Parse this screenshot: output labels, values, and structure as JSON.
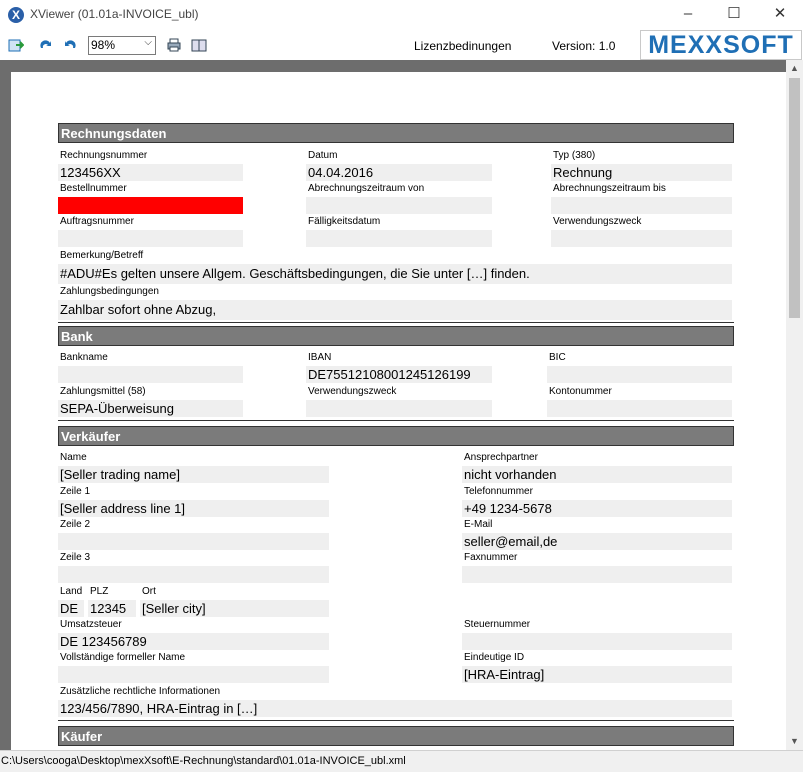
{
  "window": {
    "title": "XViewer (01.01a-INVOICE_ubl)",
    "icon": "xviewer-logo-icon",
    "minimize": "–",
    "maximize": "☐",
    "close": "✕"
  },
  "toolbar": {
    "zoom": "98%",
    "license": "Lizenzbedinungen",
    "version": "Version: 1.0",
    "logo": "MEXXSOFT",
    "accent": "#1f6fb5"
  },
  "rechnungsdaten": {
    "header": "Rechnungsdaten",
    "rechnungsnummer_label": "Rechnungsnummer",
    "rechnungsnummer": "123456XX",
    "datum_label": "Datum",
    "datum": "04.04.2016",
    "typ_label": "Typ (380)",
    "typ": "Rechnung",
    "bestellnummer_label": "Bestellnummer",
    "bestellnummer": "",
    "zeitraum_von_label": "Abrechnungszeitraum von",
    "zeitraum_von": "",
    "zeitraum_bis_label": "Abrechnungszeitraum bis",
    "zeitraum_bis": "",
    "auftragsnummer_label": "Auftragsnummer",
    "auftragsnummer": "",
    "faelligkeit_label": "Fälligkeitsdatum",
    "faelligkeit": "",
    "verwendungszweck_label": "Verwendungszweck",
    "verwendungszweck": "",
    "bemerkung_label": "Bemerkung/Betreff",
    "bemerkung": "#ADU#Es gelten unsere Allgem. Geschäftsbedingungen, die Sie unter […] finden.",
    "zahlungsbedingungen_label": "Zahlungsbedingungen",
    "zahlungsbedingungen": "Zahlbar sofort ohne Abzug,"
  },
  "bank": {
    "header": "Bank",
    "bankname_label": "Bankname",
    "bankname": "",
    "iban_label": "IBAN",
    "iban": "DE75512108001245126199",
    "bic_label": "BIC",
    "bic": "",
    "zahlungsmittel_label": "Zahlungsmittel (58)",
    "zahlungsmittel": "SEPA-Überweisung",
    "verwendungszweck_label": "Verwendungszweck",
    "verwendungszweck": "",
    "kontonummer_label": "Kontonummer",
    "kontonummer": ""
  },
  "verkaeufer": {
    "header": "Verkäufer",
    "name_label": "Name",
    "name": "[Seller trading name]",
    "ansprechpartner_label": "Ansprechpartner",
    "ansprechpartner": "nicht vorhanden",
    "zeile1_label": "Zeile 1",
    "zeile1": "[Seller address line 1]",
    "telefon_label": "Telefonnummer",
    "telefon": "+49 1234-5678",
    "zeile2_label": "Zeile 2",
    "zeile2": "",
    "email_label": "E-Mail",
    "email": "seller@email,de",
    "zeile3_label": "Zeile 3",
    "zeile3": "",
    "fax_label": "Faxnummer",
    "fax": "",
    "land_label": "Land",
    "land": "DE",
    "plz_label": "PLZ",
    "plz": "12345",
    "ort_label": "Ort",
    "ort": "[Seller city]",
    "ust_label": "Umsatzsteuer",
    "ust": "DE 123456789",
    "steuernummer_label": "Steuernummer",
    "steuernummer": "",
    "formeller_name_label": "Vollständige formeller Name",
    "formeller_name": "",
    "eindeutige_id_label": "Eindeutige ID",
    "eindeutige_id": "[HRA-Eintrag]",
    "zusatz_label": "Zusätzliche rechtliche Informationen",
    "zusatz": "123/456/7890, HRA-Eintrag in […]"
  },
  "kaeufer": {
    "header": "Käufer"
  },
  "status": {
    "path": "C:\\Users\\cooga\\Desktop\\mexXsoft\\E-Rechnung\\standard\\01.01a-INVOICE_ubl.xml"
  }
}
